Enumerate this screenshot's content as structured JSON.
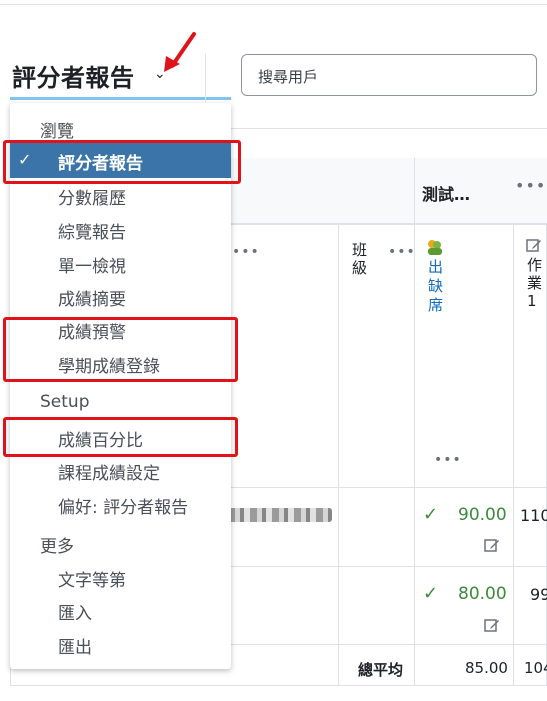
{
  "header": {
    "title": "評分者報告",
    "search_placeholder": "搜尋用戶"
  },
  "menu": {
    "groups": [
      {
        "label": "瀏覽",
        "items": [
          "評分者報告",
          "分數履歷",
          "綜覽報告",
          "單一檢視",
          "成績摘要",
          "成績預警",
          "學期成績登錄"
        ]
      },
      {
        "label": "Setup",
        "items": [
          "成績百分比",
          "課程成績設定",
          "偏好: 評分者報告"
        ]
      },
      {
        "label": "更多",
        "items": [
          "文字等第",
          "匯入",
          "匯出"
        ]
      }
    ],
    "active_item": "評分者報告"
  },
  "table": {
    "category_title": "測試…",
    "more_glyph": "•••",
    "columns": [
      {
        "label": "班級"
      },
      {
        "label": "出缺席"
      },
      {
        "label": "作業1"
      }
    ],
    "rows": [
      {
        "attendance": "90.00",
        "assign": "110"
      },
      {
        "attendance": "80.00",
        "assign": "99"
      }
    ],
    "footer": {
      "label": "總平均",
      "attendance": "85.00",
      "assign": "104"
    }
  },
  "colors": {
    "accent": "#3a74a8",
    "highlight_red": "#e0131b",
    "grade_green": "#3c8a3c",
    "link_blue": "#0f6cbf"
  }
}
